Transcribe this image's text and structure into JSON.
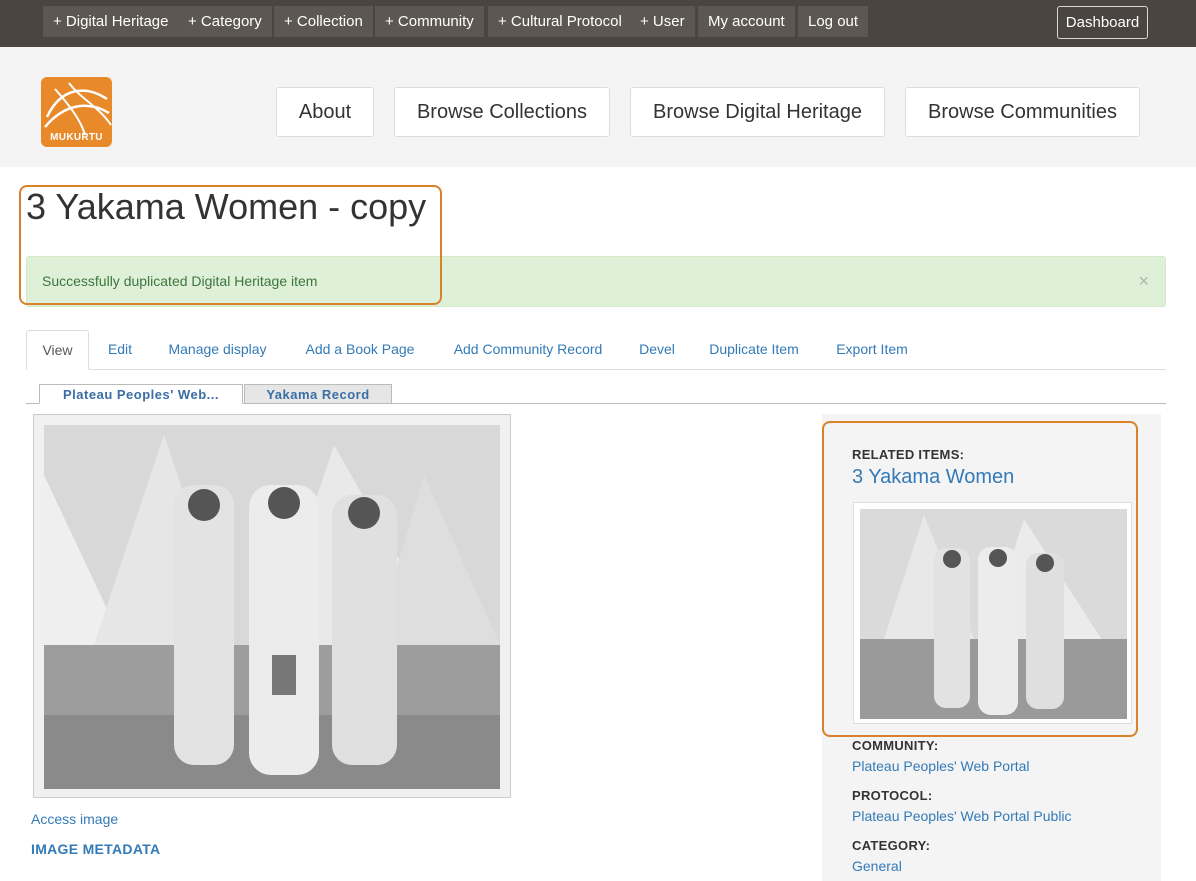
{
  "admin_bar": {
    "items": [
      "+ Digital Heritage",
      "+ Category",
      "+ Collection",
      "+ Community",
      "+ Cultural Protocol",
      "+ User",
      "My account",
      "Log out"
    ],
    "dashboard": "Dashboard"
  },
  "logo": {
    "text": "MUKURTU"
  },
  "nav": {
    "about": "About",
    "browse_collections": "Browse Collections",
    "browse_digital_heritage": "Browse Digital Heritage",
    "browse_communities": "Browse Communities"
  },
  "page": {
    "title": "3 Yakama Women - copy",
    "alert": "Successfully duplicated Digital Heritage item",
    "alert_close": "×"
  },
  "tabs": [
    "View",
    "Edit",
    "Manage display",
    "Add a Book Page",
    "Add Community Record",
    "Devel",
    "Duplicate Item",
    "Export Item"
  ],
  "subtabs": [
    "Plateau Peoples' Web...",
    "Yakama Record"
  ],
  "main": {
    "access_image": "Access image",
    "image_metadata": "IMAGE METADATA"
  },
  "sidebar": {
    "related_label": "RELATED ITEMS:",
    "related_title": "3 Yakama Women",
    "community_label": "COMMUNITY:",
    "community_value": "Plateau Peoples' Web Portal",
    "protocol_label": "PROTOCOL:",
    "protocol_value": "Plateau Peoples' Web Portal Public",
    "category_label": "CATEGORY:",
    "category_value": "General"
  },
  "colors": {
    "admin_bar": "#4a4540",
    "accent_orange": "#d9822b",
    "link": "#337ab7",
    "alert_bg": "#dff0d8"
  }
}
